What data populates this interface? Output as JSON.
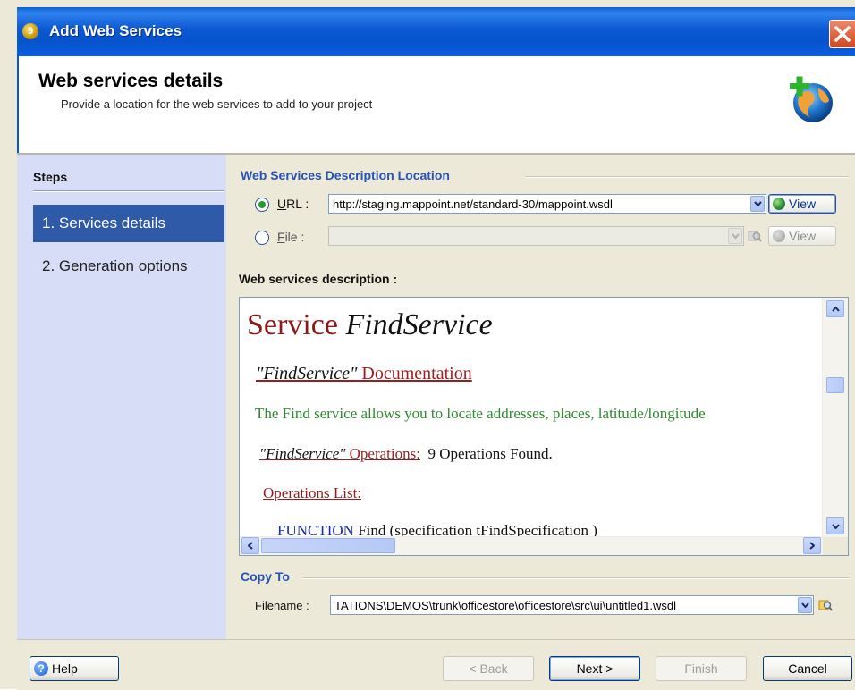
{
  "window": {
    "title": "Add Web Services",
    "app_icon": "app-logo-icon",
    "close_icon": "close-icon"
  },
  "header": {
    "title": "Web services details",
    "subtitle": "Provide a location for the web services to add to your project",
    "icon": "globe-add-icon"
  },
  "sidebar": {
    "title": "Steps",
    "items": [
      {
        "label": "1. Services details",
        "active": true
      },
      {
        "label": "2. Generation options",
        "active": false
      }
    ]
  },
  "location": {
    "group_title": "Web Services Description Location",
    "url": {
      "label": "URL :",
      "selected": true,
      "value": "http://staging.mappoint.net/standard-30/mappoint.wsdl",
      "view_label": "View"
    },
    "file": {
      "label": "File :",
      "selected": false,
      "value": "",
      "view_label": "View"
    }
  },
  "description": {
    "label": "Web services description :",
    "service_word": "Service",
    "service_name": "FindService",
    "doc_quoted": "\"FindService\"",
    "doc_word": "Documentation",
    "doc_text": "The Find service allows you to locate addresses, places, latitude/longitude",
    "ops_quoted": "\"FindService\"",
    "ops_word": "Operations:",
    "ops_count": "9 Operations Found.",
    "ops_list": "Operations List:",
    "func_kw": "FUNCTION",
    "func_rest": "Find (specification tFindSpecification )"
  },
  "copy_to": {
    "group_title": "Copy To",
    "filename_label": "Filename :",
    "filename_value": "TATIONS\\DEMOS\\trunk\\officestore\\officestore\\src\\ui\\untitled1.wsdl"
  },
  "buttons": {
    "help": "Help",
    "back": "< Back",
    "next": "Next >",
    "finish": "Finish",
    "cancel": "Cancel"
  },
  "colors": {
    "titlebar": "#0a58d3",
    "sidebar_bg": "#d7ddf7",
    "active_step": "#2f5aa8",
    "group_title": "#2553b8",
    "dialog_bg": "#ece9d8"
  }
}
